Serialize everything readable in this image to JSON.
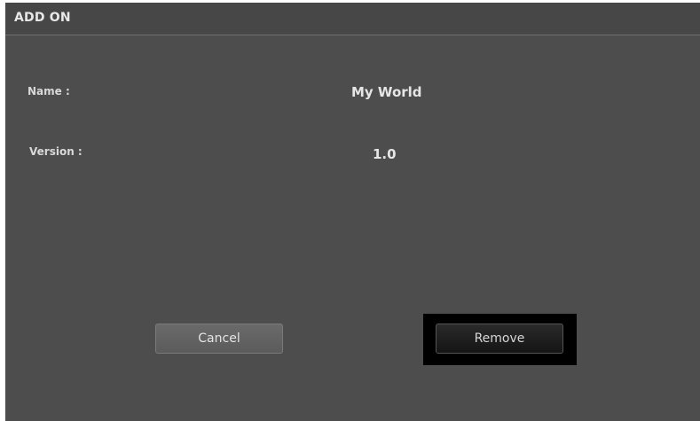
{
  "dialog": {
    "title": "ADD ON"
  },
  "fields": {
    "name_label": "Name :",
    "name_value": "My World",
    "version_label": "Version :",
    "version_value": "1.0"
  },
  "buttons": {
    "cancel_label": "Cancel",
    "remove_label": "Remove",
    "focused": "Remove"
  },
  "colors": {
    "panel_bg": "#4d4d4d",
    "titlebar_bg": "#474747",
    "focus_outline": "#000000",
    "text": "#e6e6e6"
  }
}
